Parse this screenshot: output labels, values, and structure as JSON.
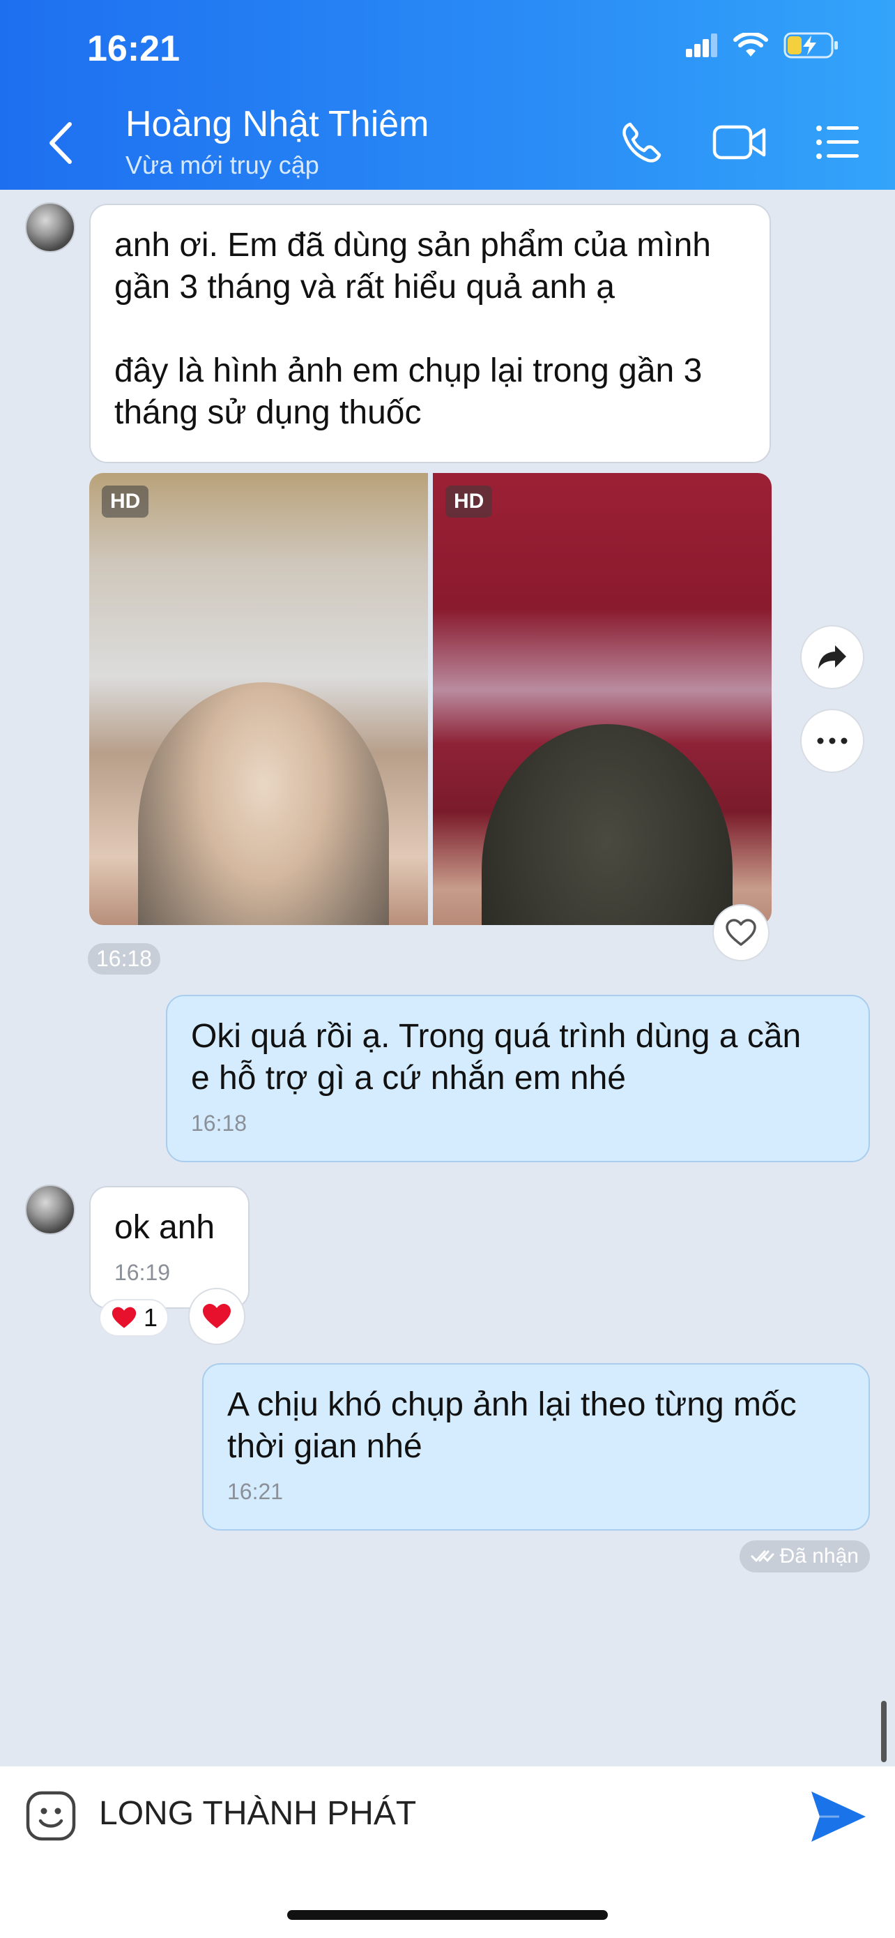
{
  "status_bar": {
    "time": "16:21"
  },
  "header": {
    "name": "Hoàng Nhật Thiêm",
    "status": "Vừa mới truy cập",
    "icons": [
      "back-arrow-icon",
      "phone-icon",
      "video-call-icon",
      "menu-list-icon"
    ]
  },
  "messages": {
    "m1_text": "anh ơi. Em đã dùng sản phẩm của mình\ngần 3 tháng và rất hiểu quả anh ạ\n\nđây là hình ảnh em chụp lại trong gần 3\ntháng sử dụng thuốc",
    "photo_badge_1": "HD",
    "photo_badge_2": "HD",
    "photo_time": "16:18",
    "m2_text": "Oki quá rồi ạ. Trong quá trình dùng a cần\ne hỗ trợ gì a cứ nhắn em nhé",
    "m2_time": "16:18",
    "m3_text": "ok anh",
    "m3_time": "16:19",
    "m3_reaction_count": "1",
    "m4_text": "A chịu khó chụp ảnh lại theo từng mốc\nthời gian nhé",
    "m4_time": "16:21",
    "delivery_status": "Đã nhận"
  },
  "input": {
    "value": "LONG THÀNH PHÁT"
  },
  "colors": {
    "header_blue": "#2a8cf6",
    "outgoing_bubble": "#d4ecfd",
    "send_blue": "#1a73e8",
    "heart_red": "#e8112d"
  }
}
